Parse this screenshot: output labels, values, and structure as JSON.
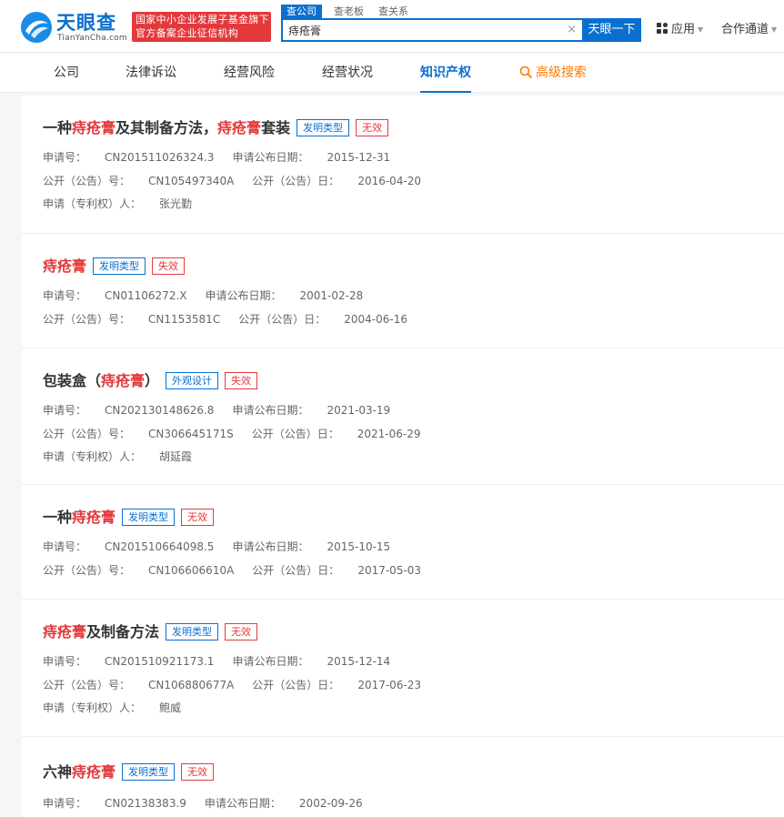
{
  "header": {
    "logo_cn": "天眼查",
    "logo_en": "TianYanCha.com",
    "gov_badge_line1": "国家中小企业发展子基金旗下",
    "gov_badge_line2": "官方备案企业征信机构",
    "search_tabs": [
      "查公司",
      "查老板",
      "查关系"
    ],
    "search_value": "痔疮膏",
    "search_clear": "×",
    "search_button": "天眼一下",
    "apps_label": "应用",
    "partner_label": "合作通道"
  },
  "nav": {
    "items": [
      "公司",
      "法律诉讼",
      "经营风险",
      "经营状况",
      "知识产权",
      "高级搜索"
    ],
    "active_index": 4
  },
  "labels": {
    "app_no": "申请号：",
    "app_pub_date": "申请公布日期：",
    "pub_no": "公开（公告）号：",
    "pub_date": "公开（公告）日：",
    "applicant": "申请（专利权）人："
  },
  "patents": [
    {
      "title_parts": [
        [
          "一种",
          false
        ],
        [
          "痔疮膏",
          true
        ],
        [
          "及其制备方法，",
          false
        ],
        [
          "痔疮膏",
          true
        ],
        [
          "套装",
          false
        ]
      ],
      "type": "发明类型",
      "status": "无效",
      "app_no": "CN201511026324.3",
      "app_pub_date": "2015-12-31",
      "pub_no": "CN105497340A",
      "pub_date": "2016-04-20",
      "applicant": "张光勤"
    },
    {
      "title_parts": [
        [
          "痔疮膏",
          true
        ]
      ],
      "type": "发明类型",
      "status": "失效",
      "app_no": "CN01106272.X",
      "app_pub_date": "2001-02-28",
      "pub_no": "CN1153581C",
      "pub_date": "2004-06-16",
      "applicant": ""
    },
    {
      "title_parts": [
        [
          "包装盒（",
          false
        ],
        [
          "痔疮膏",
          true
        ],
        [
          "）",
          false
        ]
      ],
      "type": "外观设计",
      "status": "失效",
      "app_no": "CN202130148626.8",
      "app_pub_date": "2021-03-19",
      "pub_no": "CN306645171S",
      "pub_date": "2021-06-29",
      "applicant": "胡延霞"
    },
    {
      "title_parts": [
        [
          "一种",
          false
        ],
        [
          "痔疮膏",
          true
        ]
      ],
      "type": "发明类型",
      "status": "无效",
      "app_no": "CN201510664098.5",
      "app_pub_date": "2015-10-15",
      "pub_no": "CN106606610A",
      "pub_date": "2017-05-03",
      "applicant": ""
    },
    {
      "title_parts": [
        [
          "痔疮膏",
          true
        ],
        [
          "及制备方法",
          false
        ]
      ],
      "type": "发明类型",
      "status": "无效",
      "app_no": "CN201510921173.1",
      "app_pub_date": "2015-12-14",
      "pub_no": "CN106880677A",
      "pub_date": "2017-06-23",
      "applicant": "鲍威"
    },
    {
      "title_parts": [
        [
          "六神",
          false
        ],
        [
          "痔疮膏",
          true
        ]
      ],
      "type": "发明类型",
      "status": "无效",
      "app_no": "CN02138383.9",
      "app_pub_date": "2002-09-26",
      "pub_no": "",
      "pub_date": "",
      "applicant": ""
    }
  ],
  "colors": {
    "brand_blue": "#0a6fcf",
    "highlight_red": "#e4393c",
    "advanced_orange": "#ff7a00"
  }
}
